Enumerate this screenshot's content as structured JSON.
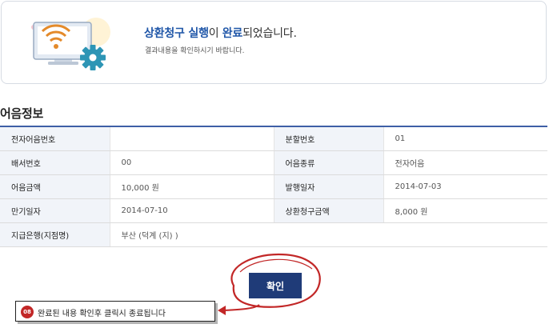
{
  "banner": {
    "title_part1": "상환청구 실행",
    "title_part2": "이 ",
    "title_part3": "완료",
    "title_part4": "되었습니다.",
    "subtitle": "결과내용을 확인하시기 바랍니다."
  },
  "section": {
    "title": "어음정보"
  },
  "table": {
    "rows": [
      {
        "label1": "전자어음번호",
        "value1": "",
        "label2": "분할번호",
        "value2": "01"
      },
      {
        "label1": "배서번호",
        "value1": "00",
        "label2": "어음종류",
        "value2": "전자어음"
      },
      {
        "label1": "어음금액",
        "value1": "10,000 원",
        "label2": "발행일자",
        "value2": "2014-07-03"
      },
      {
        "label1": "만기일자",
        "value1": "2014-07-10",
        "label2": "상환청구금액",
        "value2": "8,000 원"
      },
      {
        "label1": "지급은행(지점명)",
        "value1": "부산 (덕계 (지) )"
      }
    ]
  },
  "actions": {
    "confirm_label": "확인"
  },
  "annotation": {
    "step_number": "08",
    "text": "완료된 내용 확인후 클릭시 종료됩니다"
  },
  "colors": {
    "accent": "#1f56a8",
    "button": "#1f3b78",
    "annotation_red": "#c22727",
    "table_border": "#3e5fa6"
  }
}
